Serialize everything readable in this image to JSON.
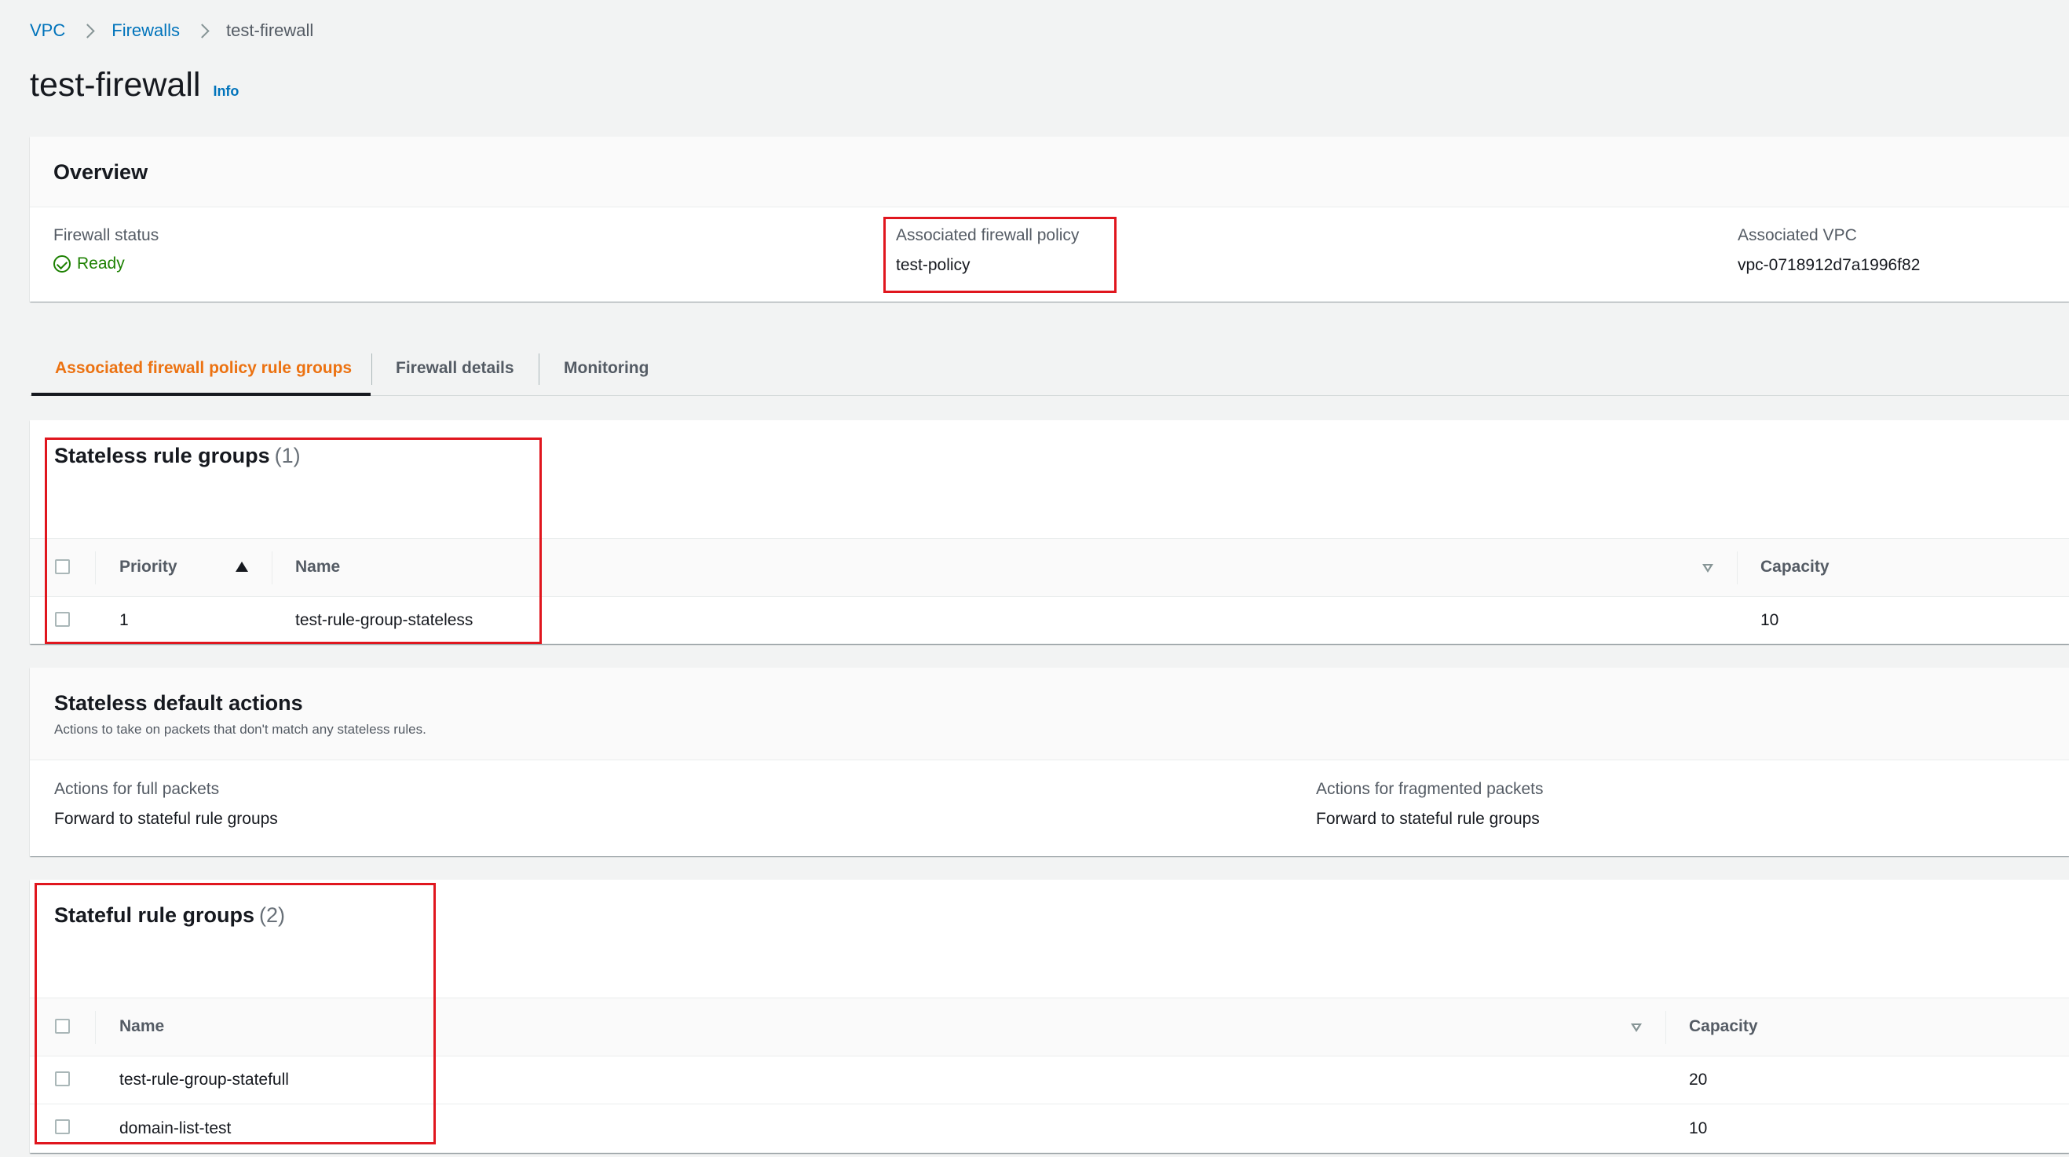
{
  "breadcrumb": {
    "vpc": "VPC",
    "firewalls": "Firewalls",
    "current": "test-firewall"
  },
  "page": {
    "title": "test-firewall",
    "info": "Info"
  },
  "overview": {
    "title": "Overview",
    "firewall_status_label": "Firewall status",
    "firewall_status_value": "Ready",
    "policy_label": "Associated firewall policy",
    "policy_value": "test-policy",
    "vpc_label": "Associated VPC",
    "vpc_value": "vpc-0718912d7a1996f82"
  },
  "tabs": [
    {
      "label": "Associated firewall policy rule groups",
      "active": true
    },
    {
      "label": "Firewall details",
      "active": false
    },
    {
      "label": "Monitoring",
      "active": false
    }
  ],
  "stateless": {
    "title": "Stateless rule groups",
    "count": "(1)",
    "columns": {
      "priority": "Priority",
      "name": "Name",
      "capacity": "Capacity"
    },
    "rows": [
      {
        "priority": "1",
        "name": "test-rule-group-stateless",
        "capacity": "10"
      }
    ]
  },
  "default_actions": {
    "title": "Stateless default actions",
    "subtitle": "Actions to take on packets that don't match any stateless rules.",
    "full_label": "Actions for full packets",
    "full_value": "Forward to stateful rule groups",
    "frag_label": "Actions for fragmented packets",
    "frag_value": "Forward to stateful rule groups"
  },
  "stateful": {
    "title": "Stateful rule groups",
    "count": "(2)",
    "columns": {
      "name": "Name",
      "capacity": "Capacity"
    },
    "rows": [
      {
        "name": "test-rule-group-statefull",
        "capacity": "20"
      },
      {
        "name": "domain-list-test",
        "capacity": "10"
      }
    ]
  },
  "colors": {
    "link": "#0073bb",
    "active_tab": "#ec7211",
    "success": "#1d8102",
    "highlight": "#e0161e"
  }
}
